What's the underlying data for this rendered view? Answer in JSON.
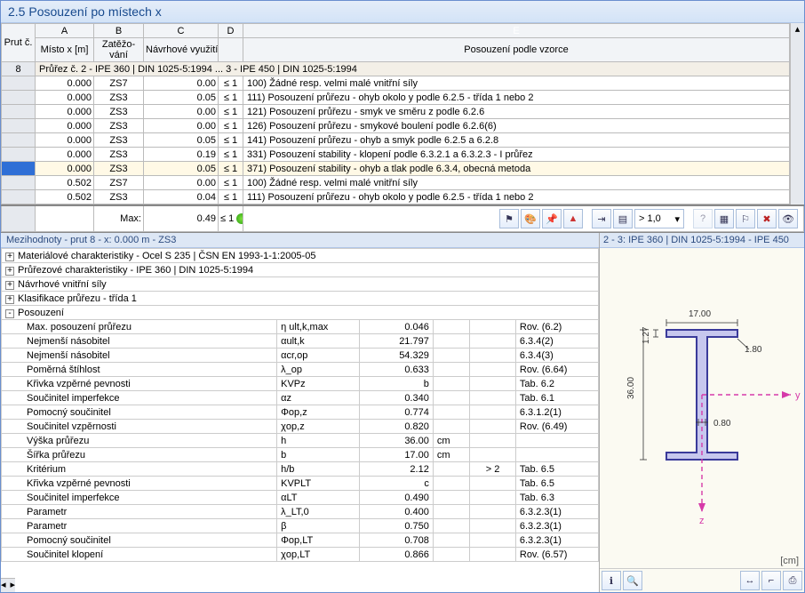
{
  "title": "2.5 Posouzení po místech x",
  "columns": {
    "rownum": "Prut č.",
    "A": "A",
    "B": "B",
    "C": "C",
    "D": "D",
    "E": "E",
    "A2": "Místo x [m]",
    "B2": "Zatěžo-\nvání",
    "C2": "Návrhové využití",
    "E2": "Posouzení podle vzorce"
  },
  "left_id": "8",
  "section_row": "Průřez č. 2 - IPE 360 | DIN 1025-5:1994 ... 3 - IPE 450 | DIN 1025-5:1994",
  "rows": [
    {
      "x": "0.000",
      "ls": "ZS7",
      "u": "0.00",
      "d": "≤ 1",
      "t": "100) Žádné resp. velmi malé vnitřní síly"
    },
    {
      "x": "0.000",
      "ls": "ZS3",
      "u": "0.05",
      "d": "≤ 1",
      "t": "111) Posouzení průřezu - ohyb okolo y podle 6.2.5 - třída 1 nebo 2"
    },
    {
      "x": "0.000",
      "ls": "ZS3",
      "u": "0.00",
      "d": "≤ 1",
      "t": "121) Posouzení průřezu - smyk ve směru z podle 6.2.6"
    },
    {
      "x": "0.000",
      "ls": "ZS3",
      "u": "0.00",
      "d": "≤ 1",
      "t": "126) Posouzení průřezu - smykové boulení podle 6.2.6(6)"
    },
    {
      "x": "0.000",
      "ls": "ZS3",
      "u": "0.05",
      "d": "≤ 1",
      "t": "141) Posouzení průřezu - ohyb a smyk podle 6.2.5 a 6.2.8"
    },
    {
      "x": "0.000",
      "ls": "ZS3",
      "u": "0.19",
      "d": "≤ 1",
      "t": "331) Posouzení stability - klopení podle 6.3.2.1 a 6.3.2.3 - I průřez"
    },
    {
      "hl": true,
      "x": "0.000",
      "ls": "ZS3",
      "u": "0.05",
      "d": "≤ 1",
      "t": "371) Posouzení stability - ohyb a tlak podle 6.3.4, obecná metoda"
    },
    {
      "x": "0.502",
      "ls": "ZS7",
      "u": "0.00",
      "d": "≤ 1",
      "t": "100) Žádné resp. velmi malé vnitřní síly"
    },
    {
      "x": "0.502",
      "ls": "ZS3",
      "u": "0.04",
      "d": "≤ 1",
      "t": "111) Posouzení průřezu - ohyb okolo y podle 6.2.5 - třída 1 nebo 2"
    }
  ],
  "max": {
    "label": "Max:",
    "val": "0.49",
    "d": "≤ 1"
  },
  "toolbar": {
    "combo": "> 1,0"
  },
  "det_head": "Mezihodnoty - prut 8 - x: 0.000 m - ZS3",
  "tree": [
    {
      "exp": "+",
      "t": "Materiálové charakteristiky - Ocel S 235 | ČSN EN 1993-1-1:2005-05"
    },
    {
      "exp": "+",
      "t": "Průřezové charakteristiky -  IPE 360 | DIN 1025-5:1994"
    },
    {
      "exp": "+",
      "t": "Návrhové vnitřní síly"
    },
    {
      "exp": "+",
      "t": "Klasifikace průřezu - třída 1"
    },
    {
      "exp": "-",
      "t": "Posouzení"
    }
  ],
  "det": [
    {
      "n": "Max. posouzení průřezu",
      "s": "η ult,k,max",
      "v": "0.046",
      "u": "",
      "r": "Rov. (6.2)"
    },
    {
      "n": "Nejmenší násobitel",
      "s": "αult,k",
      "v": "21.797",
      "u": "",
      "r": "6.3.4(2)"
    },
    {
      "n": "Nejmenší násobitel",
      "s": "αcr,op",
      "v": "54.329",
      "u": "",
      "r": "6.3.4(3)"
    },
    {
      "n": "Poměrná štíhlost",
      "s": "λ_op",
      "v": "0.633",
      "u": "",
      "r": "Rov. (6.64)"
    },
    {
      "n": "Křivka vzpěrné pevnosti",
      "s": "KVPz",
      "v": "b",
      "u": "",
      "r": "Tab. 6.2"
    },
    {
      "n": "Součinitel imperfekce",
      "s": "αz",
      "v": "0.340",
      "u": "",
      "r": "Tab. 6.1"
    },
    {
      "n": "Pomocný součinitel",
      "s": "Φop,z",
      "v": "0.774",
      "u": "",
      "r": "6.3.1.2(1)"
    },
    {
      "n": "Součinitel vzpěrnosti",
      "s": "χop,z",
      "v": "0.820",
      "u": "",
      "r": "Rov. (6.49)"
    },
    {
      "n": "Výška průřezu",
      "s": "h",
      "v": "36.00",
      "u": "cm",
      "r": ""
    },
    {
      "n": "Šířka průřezu",
      "s": "b",
      "v": "17.00",
      "u": "cm",
      "r": ""
    },
    {
      "n": "Kritérium",
      "s": "h/b",
      "v": "2.12",
      "u": "",
      "c": "> 2",
      "r": "Tab. 6.5"
    },
    {
      "n": "Křivka vzpěrné pevnosti",
      "s": "KVPLT",
      "v": "c",
      "u": "",
      "r": "Tab. 6.5"
    },
    {
      "n": "Součinitel imperfekce",
      "s": "αLT",
      "v": "0.490",
      "u": "",
      "r": "Tab. 6.3"
    },
    {
      "n": "Parametr",
      "s": "λ_LT,0",
      "v": "0.400",
      "u": "",
      "r": "6.3.2.3(1)"
    },
    {
      "n": "Parametr",
      "s": "β",
      "v": "0.750",
      "u": "",
      "r": "6.3.2.3(1)"
    },
    {
      "n": "Pomocný součinitel",
      "s": "Φop,LT",
      "v": "0.708",
      "u": "",
      "r": "6.3.2.3(1)"
    },
    {
      "n": "Součinitel klopení",
      "s": "χop,LT",
      "v": "0.866",
      "u": "",
      "r": "Rov. (6.57)"
    }
  ],
  "side_head": "2 - 3: IPE 360 | DIN 1025-5:1994 - IPE 450",
  "profile": {
    "w": "17.00",
    "h": "36.00",
    "tf": "1.27",
    "tw": "0.80",
    "r": "1.80",
    "unit": "[cm]",
    "ylabel": "y",
    "zlabel": "z"
  }
}
